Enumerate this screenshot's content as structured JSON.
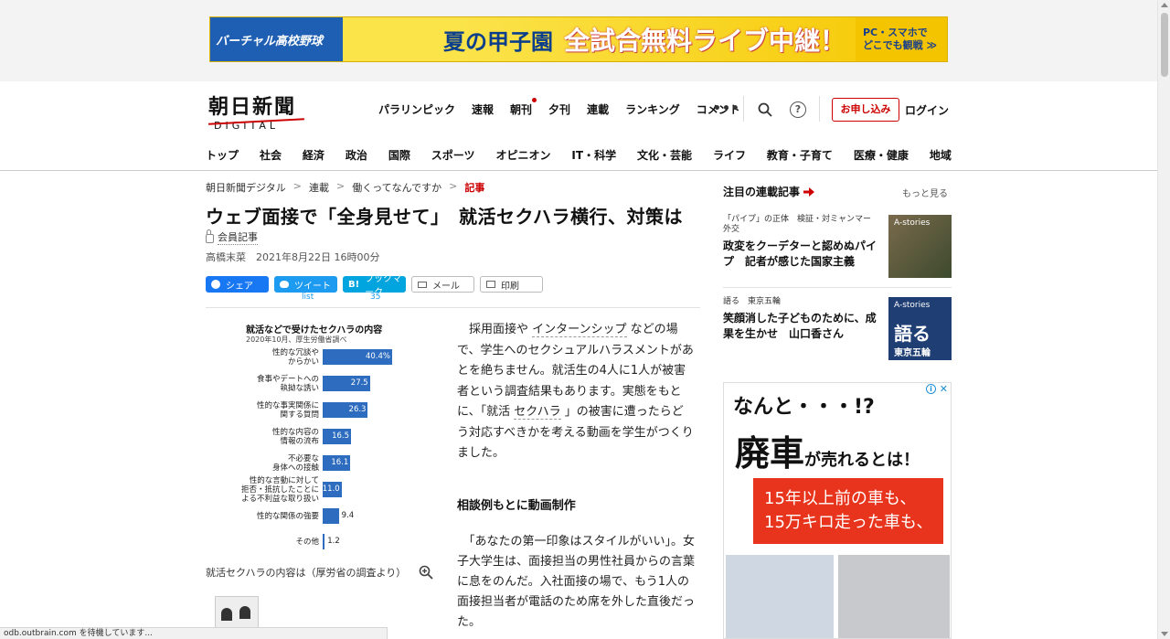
{
  "ad_banner": {
    "left": "バーチャル高校野球",
    "middle": "夏の甲子園",
    "main": "全試合無料ライブ中継！",
    "right_line1": "PC・スマホで",
    "right_line2": "どこでも観戦 ≫"
  },
  "header": {
    "logo_main": "朝日新聞",
    "logo_sub": "DIGITAL",
    "top_nav": [
      "パラリンピック",
      "速報",
      "朝刊",
      "夕刊",
      "連載",
      "ランキング",
      "コメント"
    ],
    "more": "•••",
    "help": "?",
    "subscribe": "お申し込み",
    "login": "ログイン",
    "main_nav": [
      "トップ",
      "社会",
      "経済",
      "政治",
      "国際",
      "スポーツ",
      "オピニオン",
      "IT・科学",
      "文化・芸能",
      "ライフ",
      "教育・子育て",
      "医療・健康",
      "地域"
    ]
  },
  "breadcrumb": {
    "items": [
      "朝日新聞デジタル",
      "連載",
      "働くってなんですか",
      "記事"
    ],
    "separator": ">"
  },
  "article": {
    "headline": "ウェブ面接で「全身見せて」　就活セクハラ横行、対策は",
    "member_label": "会員記事",
    "byline": "高橋末菜　2021年8月22日 16時00分",
    "share": {
      "facebook": "シェア",
      "twitter": "ツイート",
      "hatena_prefix": "B!",
      "hatena": "ブックマーク",
      "mail": "メール",
      "print": "印刷",
      "twitter_count": "list",
      "hatena_count": "35"
    },
    "body_p1_a": "採用面接や",
    "body_p1_link1": "インターンシップ",
    "body_p1_b": "などの場で、学生へのセクシュアルハラスメントがあとを絶ちません。就活生の4人に1人が被害者という調査結果もあります。実態をもとに、「就活",
    "body_p1_link2": "セクハラ",
    "body_p1_c": "」の被害に遭ったらどう対応すべきかを考える動画を学生がつくりました。",
    "subhead": "相談例もとに動画制作",
    "body_p2": "「あなたの第一印象はスタイルがいい」。女子大学生は、面接担当の男性社員からの言葉に息をのんだ。入社面接の場で、もう1人の面接担当者が電話のため席を外した直後だった。",
    "figure_caption": "就活セクハラの内容は（厚労省の調査より）"
  },
  "chart_data": {
    "type": "bar",
    "title": "就活などで受けたセクハラの内容",
    "subtitle": "2020年10月、厚生労働省調べ",
    "categories": [
      "性的な冗談や\nからかい",
      "食事やデートへの\n執拗な誘い",
      "性的な事実関係に\n関する質問",
      "性的な内容の\n情報の流布",
      "不必要な\n身体への接触",
      "性的な言動に対して\n拒否・抵抗したことに\nよる不利益な取り扱い",
      "性的な関係の強要",
      "その他"
    ],
    "values": [
      40.4,
      27.5,
      26.3,
      16.5,
      16.1,
      11.0,
      9.4,
      1.2
    ],
    "value_labels": [
      "40.4%",
      "27.5",
      "26.3",
      "16.5",
      "16.1",
      "11.0",
      "9.4",
      "1.2"
    ],
    "xlim": [
      0,
      40.4
    ],
    "bar_color": "#2d6cbf"
  },
  "sidebar": {
    "title": "注目の連載記事",
    "more": "もっと見る",
    "items": [
      {
        "kicker": "「パイプ」の正体　検証・対ミャンマー外交",
        "title": "政変をクーデターと認めぬパイプ　記者が感じた国家主義",
        "thumb_label": "A-stories"
      },
      {
        "kicker": "語る　東京五輪",
        "title": "笑顔消した子どものために、成果を生かせ　山口香さん",
        "thumb_label": "A-stories",
        "thumb_big": "語る",
        "thumb_small": "東京五輪"
      }
    ]
  },
  "ad": {
    "line1": "なんと・・・!?",
    "line2_big": "廃車",
    "line2_small": "が売れるとは！",
    "red_line1": "15年以上前の車も、",
    "red_line2": "15万キロ走った車も、"
  },
  "status_bar": "odb.outbrain.com を待機しています..."
}
